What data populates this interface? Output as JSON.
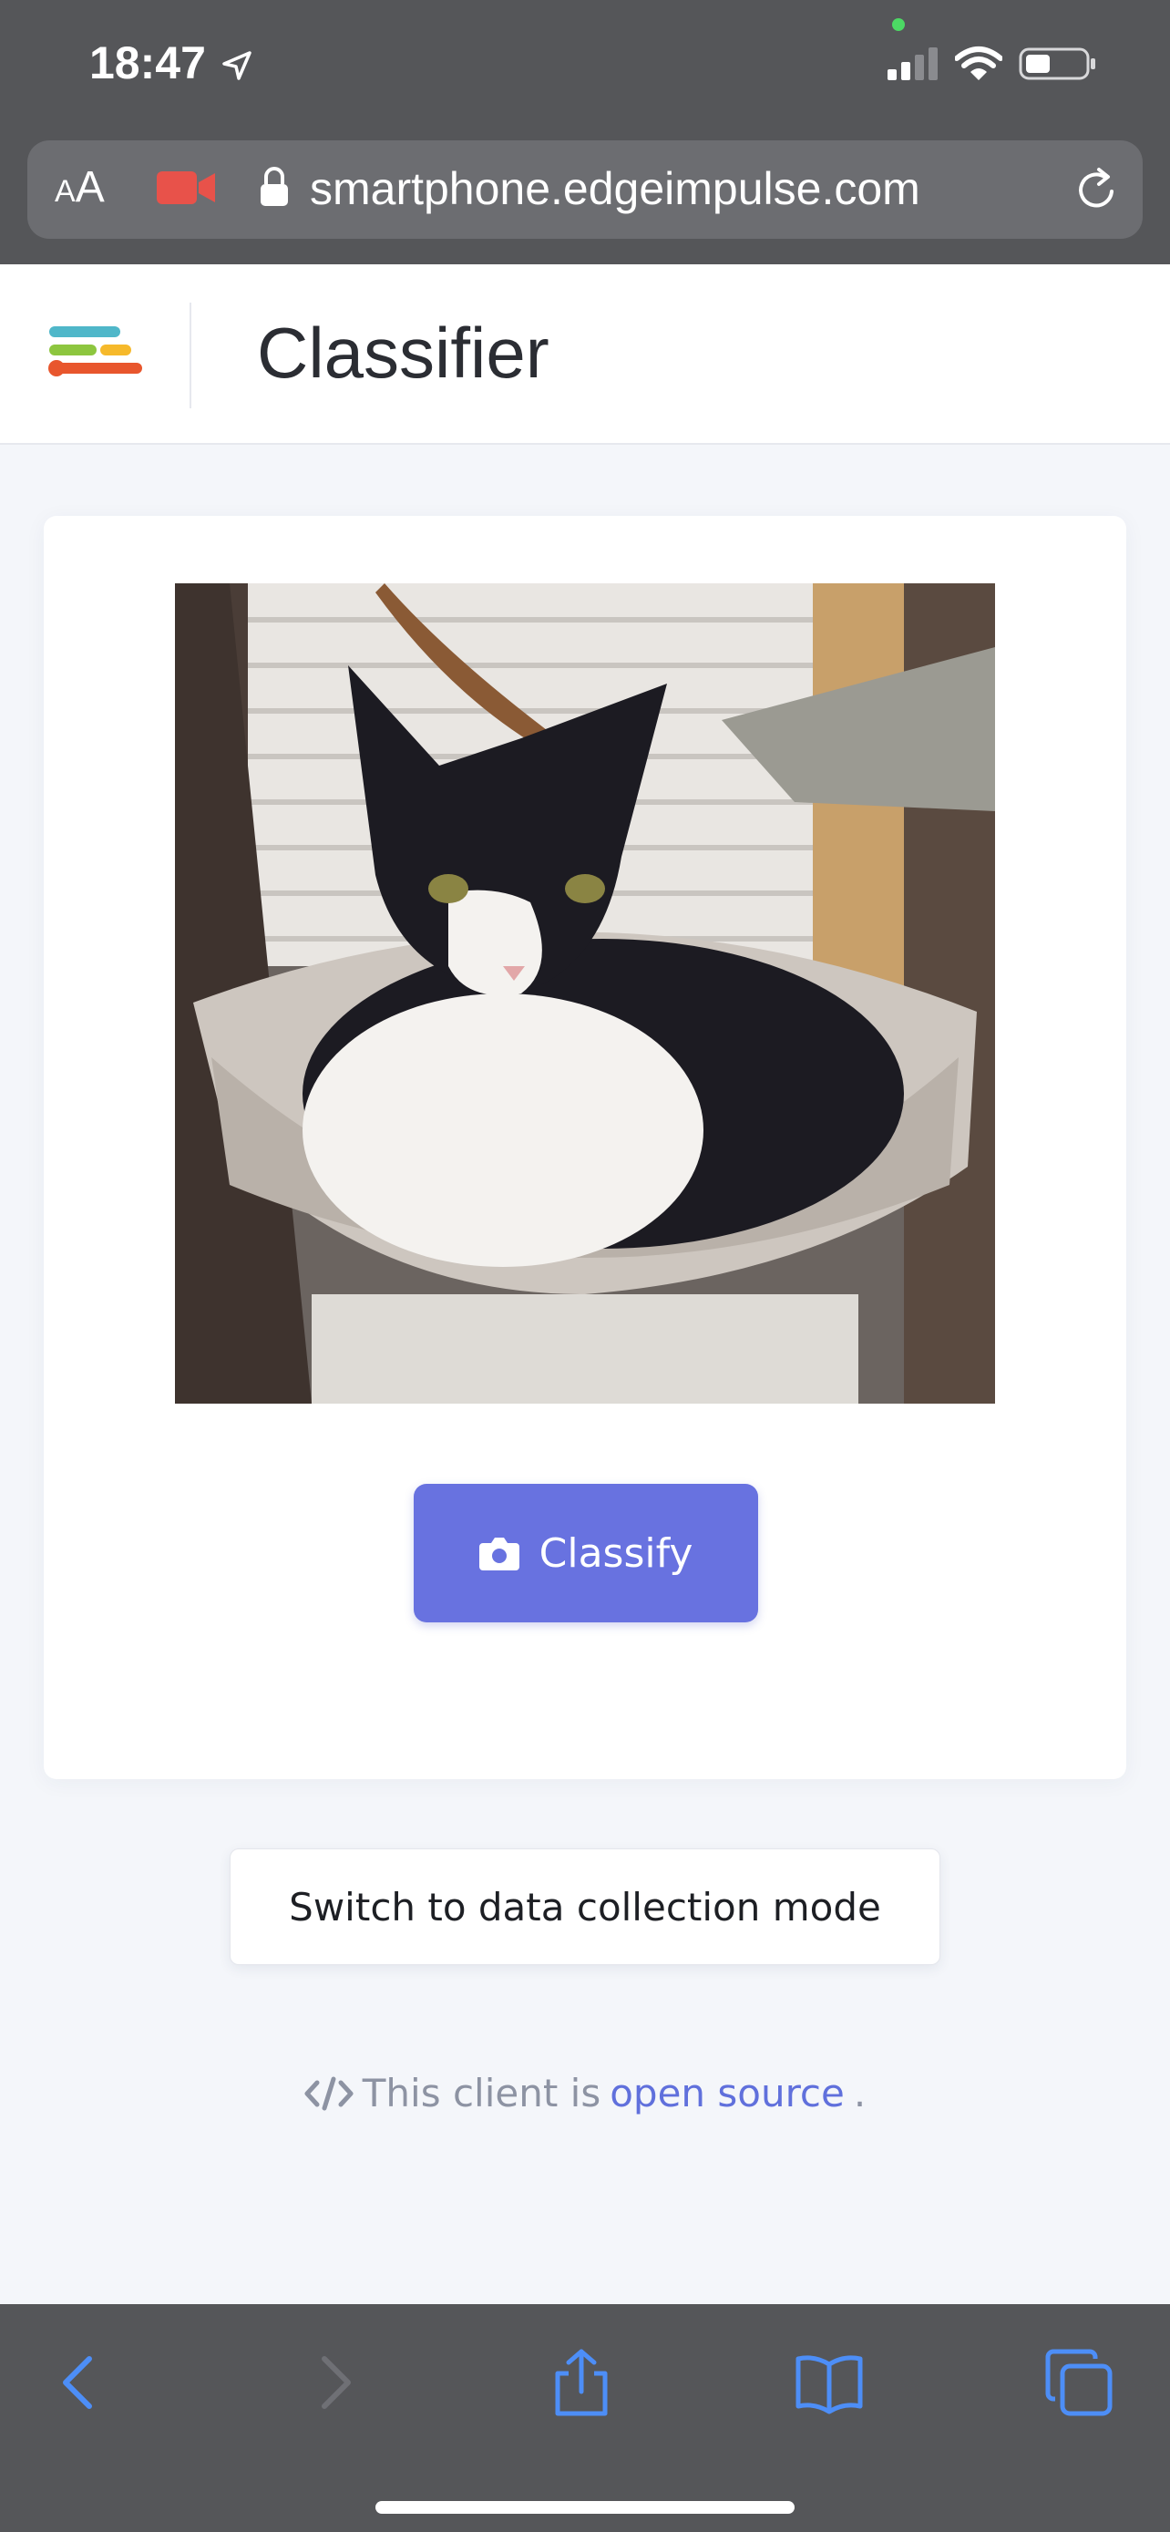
{
  "status_bar": {
    "time": "18:47"
  },
  "browser": {
    "text_size_label": "AA",
    "url": "smartphone.edgeimpulse.com"
  },
  "header": {
    "title": "Classifier"
  },
  "card": {
    "classify_label": "Classify"
  },
  "switch_mode_label": "Switch to data collection mode",
  "footer": {
    "prefix": "This client is ",
    "link_text": "open source",
    "suffix": "."
  },
  "colors": {
    "accent": "#6872e0",
    "chrome": "#555659",
    "toolbar_icon": "#4d8ef7",
    "record": "#e8524a"
  },
  "icons": [
    "location-arrow-icon",
    "signal-icon",
    "wifi-icon",
    "battery-icon",
    "camera-record-icon",
    "lock-icon",
    "reload-icon",
    "camera-icon",
    "code-icon",
    "back-icon",
    "forward-icon",
    "share-icon",
    "bookmarks-icon",
    "tabs-icon"
  ]
}
